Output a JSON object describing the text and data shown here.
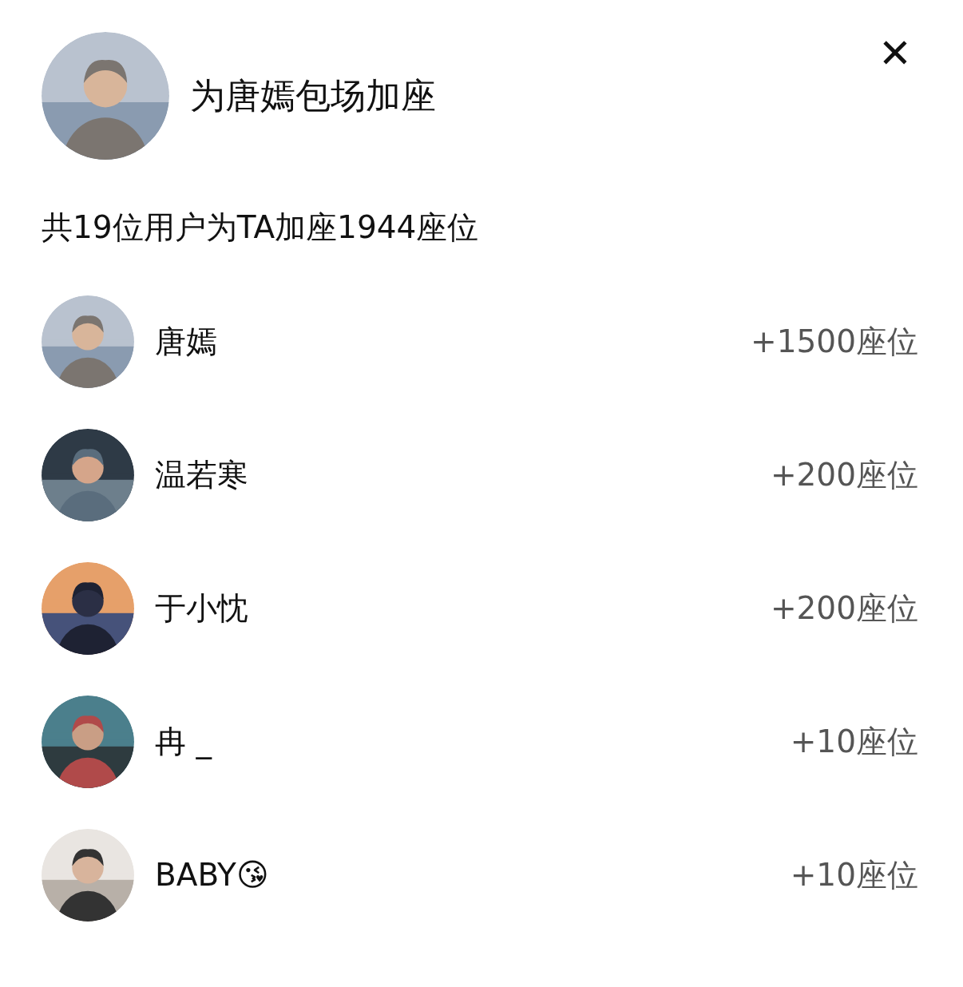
{
  "header": {
    "title": "为唐嫣包场加座",
    "close_label": "✕"
  },
  "summary": "共19位用户为TA加座1944座位",
  "users": [
    {
      "name": "唐嫣",
      "seats": "+1500座位"
    },
    {
      "name": "温若寒",
      "seats": "+200座位"
    },
    {
      "name": "于小忱",
      "seats": "+200座位"
    },
    {
      "name": "冉 _",
      "seats": "+10座位"
    },
    {
      "name": "BABY😘",
      "seats": "+10座位"
    }
  ]
}
